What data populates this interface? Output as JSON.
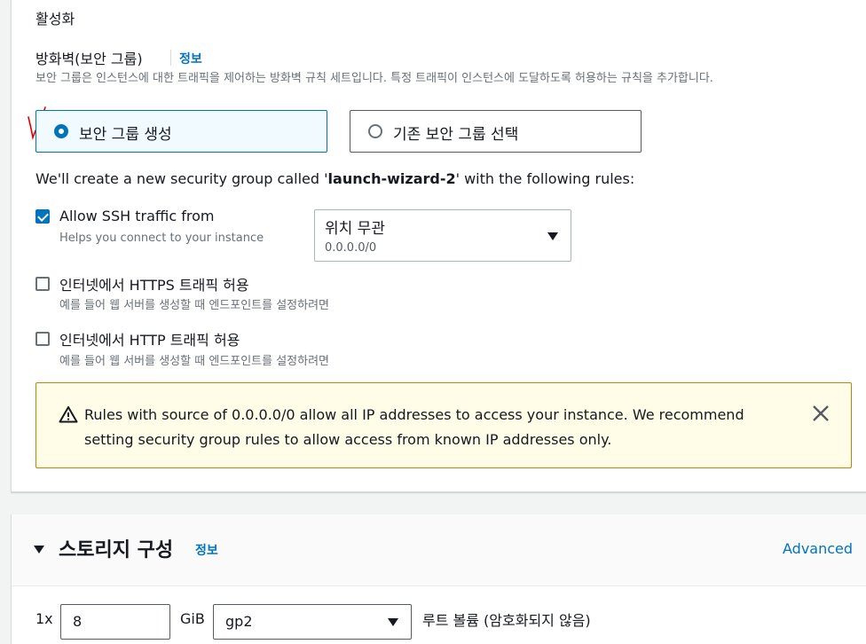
{
  "activation": {
    "label": "활성화"
  },
  "firewall": {
    "label": "방화벽(보안 그룹)",
    "info": "정보",
    "description": "보안 그룹은 인스턴스에 대한 트래픽을 제어하는 방화벽 규칙 세트입니다. 특정 트래픽이 인스턴스에 도달하도록 허용하는 규칙을 추가합니다.",
    "options": [
      {
        "label": "보안 그룹 생성",
        "selected": true
      },
      {
        "label": "기존 보안 그룹 선택",
        "selected": false
      }
    ]
  },
  "wizard_note": {
    "prefix": "We'll create a new security group called '",
    "group_name": "launch-wizard-2",
    "suffix": "' with the following rules:"
  },
  "ssh": {
    "label": "Allow SSH traffic from",
    "description": "Helps you connect to your instance",
    "checked": true,
    "select_value": "위치 무관",
    "select_sub": "0.0.0.0/0"
  },
  "https": {
    "label": "인터넷에서 HTTPS 트래픽 허용",
    "description": "예를 들어 웹 서버를 생성할 때 엔드포인트를 설정하려면",
    "checked": false
  },
  "http": {
    "label": "인터넷에서 HTTP 트래픽 허용",
    "description": "예를 들어 웹 서버를 생성할 때 엔드포인트를 설정하려면",
    "checked": false
  },
  "alert": {
    "text": "Rules with source of 0.0.0.0/0 allow all IP addresses to access your instance. We recommend setting security group rules to allow access from known IP addresses only.",
    "icon": "warning-icon",
    "close_icon": "close-icon"
  },
  "storage": {
    "title": "스토리지 구성",
    "info": "정보",
    "advanced": "Advanced",
    "multiplier": "1x",
    "size": "8",
    "unit": "GiB",
    "volume_type": "gp2",
    "volume_label": "루트 볼륨  (암호화되지 않음)"
  },
  "colors": {
    "accent": "#0073bb",
    "warning_border": "#b8860b",
    "warning_bg": "#fffce8",
    "annotation": "#e00000"
  }
}
